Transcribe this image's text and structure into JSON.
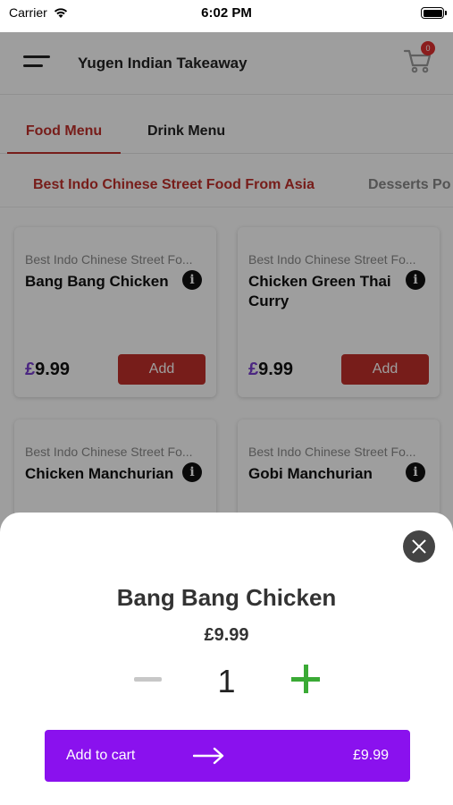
{
  "status_bar": {
    "carrier": "Carrier",
    "time": "6:02 PM"
  },
  "header": {
    "title": "Yugen Indian Takeaway",
    "cart_count": "0"
  },
  "menu_tabs": [
    {
      "label": "Food Menu",
      "active": true
    },
    {
      "label": "Drink Menu",
      "active": false
    }
  ],
  "category_tabs": [
    {
      "label": "Best Indo Chinese Street Food From Asia",
      "active": true
    },
    {
      "label": "Desserts Po",
      "active": false
    }
  ],
  "items": [
    {
      "category": "Best Indo Chinese Street Fo...",
      "name": "Bang Bang Chicken",
      "currency": "£",
      "price": "9.99",
      "add_label": "Add"
    },
    {
      "category": "Best Indo Chinese Street Fo...",
      "name": "Chicken Green Thai Curry",
      "currency": "£",
      "price": "9.99",
      "add_label": "Add"
    },
    {
      "category": "Best Indo Chinese Street Fo...",
      "name": "Chicken Manchurian"
    },
    {
      "category": "Best Indo Chinese Street Fo...",
      "name": "Gobi Manchurian"
    }
  ],
  "sheet": {
    "title": "Bang Bang Chicken",
    "price": "£9.99",
    "quantity": "1",
    "add_to_cart_label": "Add to cart",
    "total": "£9.99"
  },
  "colors": {
    "accent_red": "#c0302b",
    "purple": "#8a11ee",
    "plus_green": "#3aaa35"
  },
  "icons": [
    "wifi-icon",
    "battery-icon",
    "hamburger-menu-icon",
    "cart-icon",
    "info-icon",
    "close-icon",
    "minus-icon",
    "plus-icon",
    "arrow-right-icon"
  ]
}
